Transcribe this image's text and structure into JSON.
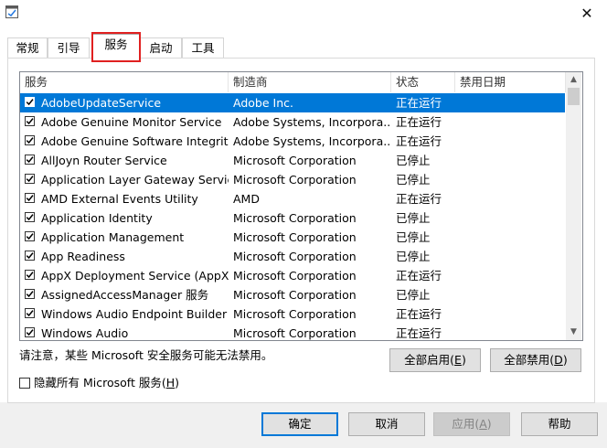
{
  "window": {
    "close_glyph": "✕"
  },
  "tabs": [
    {
      "label": "常规",
      "active": false
    },
    {
      "label": "引导",
      "active": false
    },
    {
      "label": "服务",
      "active": true
    },
    {
      "label": "启动",
      "active": false
    },
    {
      "label": "工具",
      "active": false
    }
  ],
  "services_list": {
    "columns": [
      "服务",
      "制造商",
      "状态",
      "禁用日期"
    ],
    "rows": [
      {
        "name": "AdobeUpdateService",
        "maker": "Adobe Inc.",
        "status": "正在运行",
        "date": "",
        "checked": true,
        "selected": true
      },
      {
        "name": "Adobe Genuine Monitor Service",
        "maker": "Adobe Systems, Incorpora...",
        "status": "正在运行",
        "date": "",
        "checked": true,
        "selected": false
      },
      {
        "name": "Adobe Genuine Software Integrit...",
        "maker": "Adobe Systems, Incorpora...",
        "status": "正在运行",
        "date": "",
        "checked": true,
        "selected": false
      },
      {
        "name": "AllJoyn Router Service",
        "maker": "Microsoft Corporation",
        "status": "已停止",
        "date": "",
        "checked": true,
        "selected": false
      },
      {
        "name": "Application Layer Gateway Service",
        "maker": "Microsoft Corporation",
        "status": "已停止",
        "date": "",
        "checked": true,
        "selected": false
      },
      {
        "name": "AMD External Events Utility",
        "maker": "AMD",
        "status": "正在运行",
        "date": "",
        "checked": true,
        "selected": false
      },
      {
        "name": "Application Identity",
        "maker": "Microsoft Corporation",
        "status": "已停止",
        "date": "",
        "checked": true,
        "selected": false
      },
      {
        "name": "Application Management",
        "maker": "Microsoft Corporation",
        "status": "已停止",
        "date": "",
        "checked": true,
        "selected": false
      },
      {
        "name": "App Readiness",
        "maker": "Microsoft Corporation",
        "status": "已停止",
        "date": "",
        "checked": true,
        "selected": false
      },
      {
        "name": "AppX Deployment Service (AppX...",
        "maker": "Microsoft Corporation",
        "status": "正在运行",
        "date": "",
        "checked": true,
        "selected": false
      },
      {
        "name": "AssignedAccessManager 服务",
        "maker": "Microsoft Corporation",
        "status": "已停止",
        "date": "",
        "checked": true,
        "selected": false
      },
      {
        "name": "Windows Audio Endpoint Builder",
        "maker": "Microsoft Corporation",
        "status": "正在运行",
        "date": "",
        "checked": true,
        "selected": false
      },
      {
        "name": "Windows Audio",
        "maker": "Microsoft Corporation",
        "status": "正在运行",
        "date": "",
        "checked": true,
        "selected": false
      }
    ]
  },
  "note": "请注意，某些 Microsoft 安全服务可能无法禁用。",
  "enable_all_label": "全部启用(",
  "enable_all_key": "E",
  "disable_all_label": "全部禁用(",
  "disable_all_key": "D",
  "hide_ms_label": "隐藏所有 Microsoft 服务(",
  "hide_ms_key": "H",
  "footer": {
    "ok": "确定",
    "cancel": "取消",
    "apply_label": "应用(",
    "apply_key": "A",
    "help": "帮助"
  },
  "colors": {
    "selection": "#0078d7",
    "highlight_box": "#e02020"
  }
}
